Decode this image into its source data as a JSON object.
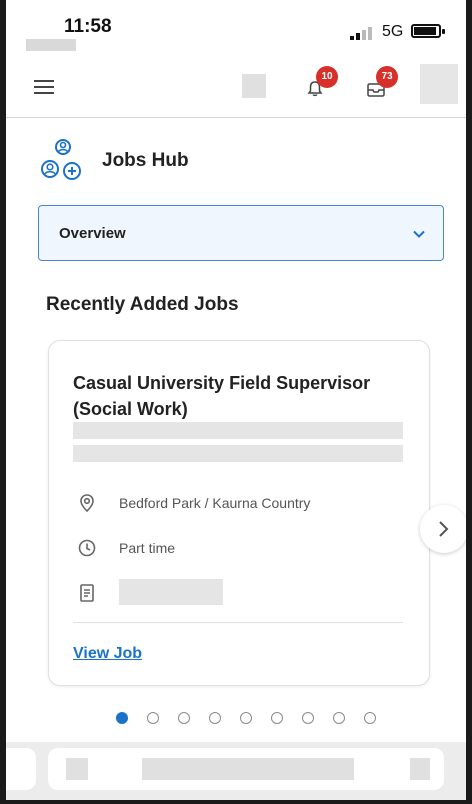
{
  "status_bar": {
    "time": "11:58",
    "network": "5G"
  },
  "app_bar": {
    "notifications_count": "10",
    "inbox_count": "73"
  },
  "hub": {
    "title": "Jobs Hub"
  },
  "view_selector": {
    "selected": "Overview"
  },
  "section": {
    "title": "Recently Added Jobs"
  },
  "job_card": {
    "title": "Casual University Field Supervisor (Social Work)",
    "location": "Bedford Park / Kaurna Country",
    "time_type": "Part time",
    "link_label": "View Job"
  },
  "pagination": {
    "total": 9,
    "active_index": 0
  },
  "colors": {
    "accent": "#1a73c9",
    "badge": "#d7302a",
    "dropdown_border": "#4a86d4",
    "dropdown_bg": "#f0f6fd"
  },
  "icons": {
    "menu": "hamburger-menu-icon",
    "notifications": "bell-icon",
    "inbox": "inbox-icon",
    "hub": "people-add-icon",
    "location": "location-pin-icon",
    "time": "clock-icon",
    "requisition": "document-icon",
    "next": "chevron-right-icon"
  }
}
